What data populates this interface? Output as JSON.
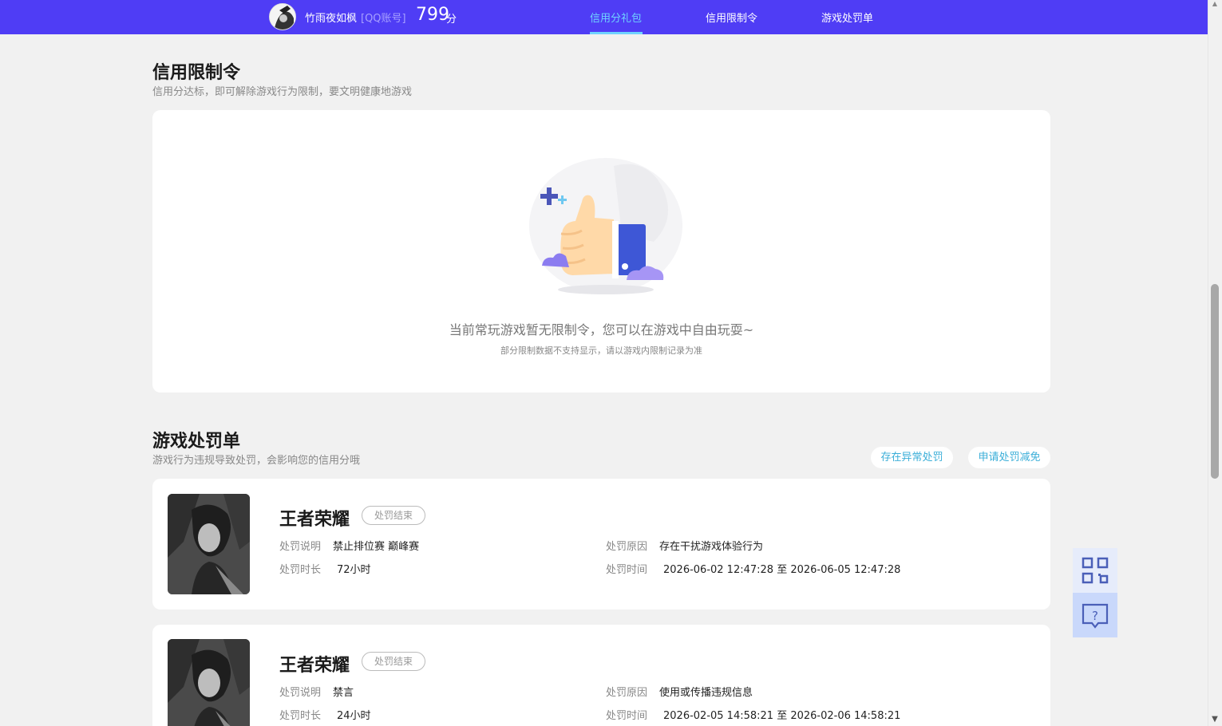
{
  "header": {
    "username": "竹雨夜如枫",
    "account_type": "[QQ账号]",
    "score": "799",
    "score_unit": "分",
    "tabs": [
      {
        "label": "信用分礼包",
        "active": true
      },
      {
        "label": "信用限制令",
        "active": false
      },
      {
        "label": "游戏处罚单",
        "active": false
      }
    ]
  },
  "restriction": {
    "title": "信用限制令",
    "subtitle": "信用分达标，即可解除游戏行为限制，要文明健康地游戏",
    "empty_text": "当前常玩游戏暂无限制令，您可以在游戏中自由玩耍~",
    "empty_note": "部分限制数据不支持显示，请以游戏内限制记录为准"
  },
  "penalty": {
    "title": "游戏处罚单",
    "subtitle": "游戏行为违规导致处罚，会影响您的信用分哦",
    "btn_abnormal": "存在异常处罚",
    "btn_appeal": "申请处罚减免",
    "labels": {
      "desc": "处罚说明",
      "reason": "处罚原因",
      "duration": "处罚时长",
      "time": "处罚时间"
    },
    "records": [
      {
        "game": "王者荣耀",
        "status": "处罚结束",
        "desc": "禁止排位赛 巅峰赛",
        "reason": "存在干扰游戏体验行为",
        "duration": "72小时",
        "time": "2026-06-02 12:47:28 至 2026-06-05 12:47:28"
      },
      {
        "game": "王者荣耀",
        "status": "处罚结束",
        "desc": "禁言",
        "reason": "使用或传播违规信息",
        "duration": "24小时",
        "time": "2026-02-05 14:58:21 至 2026-02-06 14:58:21"
      }
    ]
  },
  "colors": {
    "header_bg": "#4f3df5",
    "active_tab": "#6fd3ff",
    "link": "#3aaed8"
  },
  "icons": {
    "qr": "qr-code-icon",
    "help": "help-chat-icon",
    "illustration": "thumbs-up-illustration"
  }
}
